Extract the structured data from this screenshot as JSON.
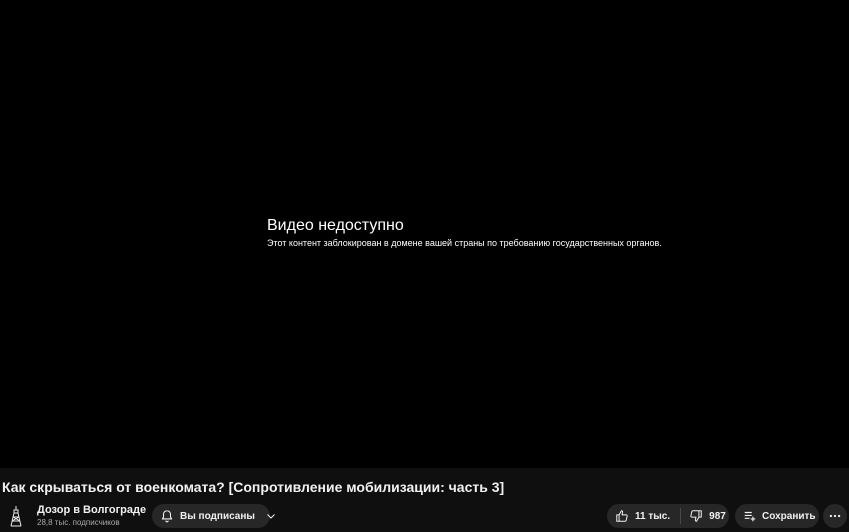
{
  "player": {
    "error_title": "Видео недоступно",
    "error_message": "Этот контент заблокирован в домене вашей страны по требованию государственных органов."
  },
  "video": {
    "title": "Как скрываться от военкомата? [Сопротивление мобилизации: часть 3]"
  },
  "channel": {
    "name": "Дозор в Волгограде",
    "subscribers": "28,8 тыс. подписчиков",
    "subscribe_label": "Вы подписаны"
  },
  "actions": {
    "like_count": "11 тыс.",
    "dislike_count": "987",
    "save_label": "Сохранить"
  },
  "icons": {
    "bell": "bell-icon",
    "chevron": "chevron-down-icon",
    "like": "thumb-up-icon",
    "dislike": "thumb-down-icon",
    "save": "playlist-add-icon",
    "more": "more-horizontal-icon"
  }
}
